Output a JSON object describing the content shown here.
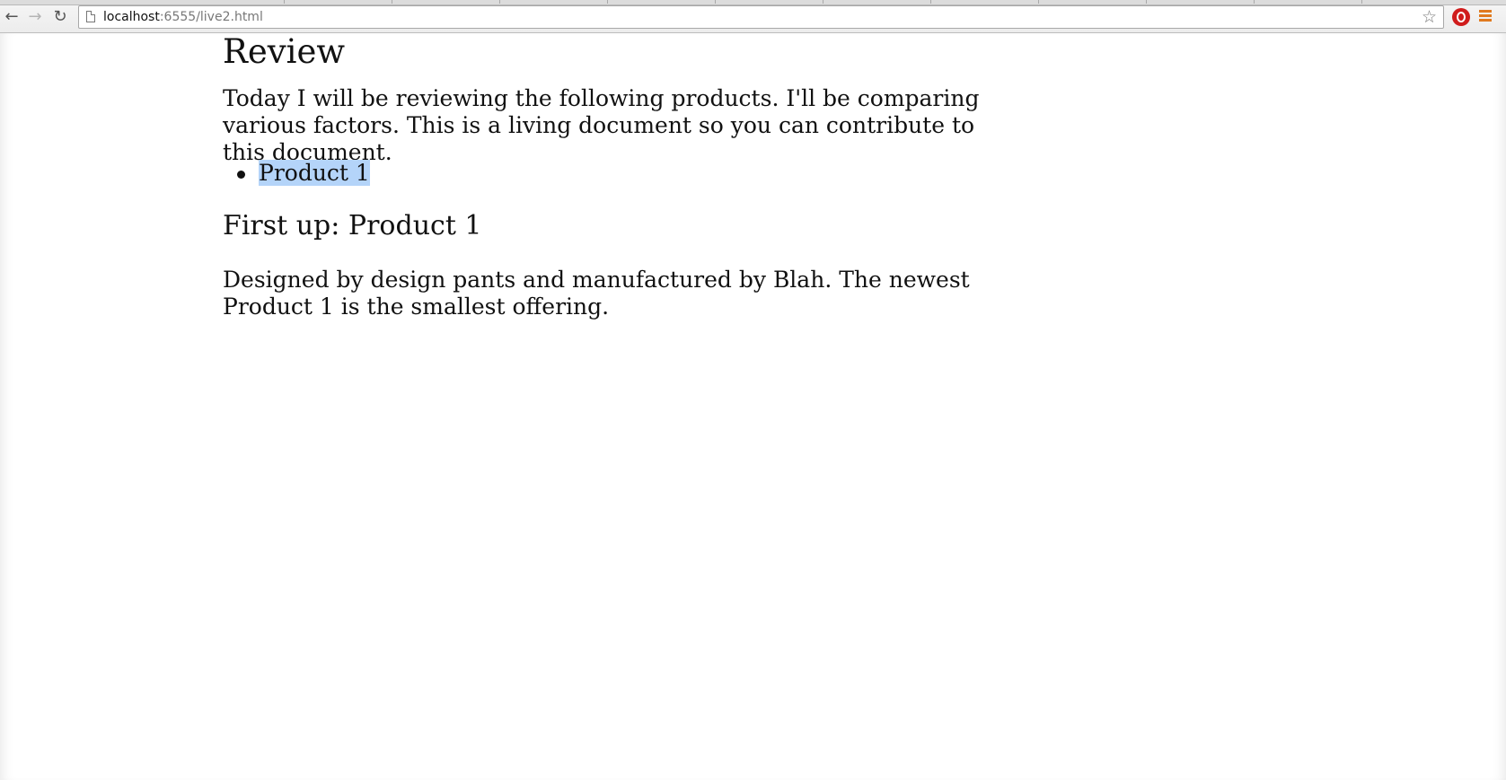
{
  "browser": {
    "url_host": "localhost",
    "url_rest": ":6555/live2.html",
    "back_icon": "arrow-left-icon",
    "forward_icon": "arrow-right-icon",
    "reload_icon": "reload-icon",
    "bookmark_icon": "star-icon",
    "extension_icon": "red-circle-extension-icon",
    "menu_icon": "hamburger-menu-icon",
    "colors": {
      "extension": "#d01c1c",
      "menu": "#e07a1f",
      "selection": "#b4d4f9"
    }
  },
  "page": {
    "title": "Review",
    "intro": "Today I will be reviewing the following products. I'll be comparing various factors. This is a living document so you can contribute to this document.",
    "list": [
      {
        "label": "Product 1",
        "selected": true
      }
    ],
    "section_heading": "First up: Product 1",
    "section_text": "Designed by design pants and manufactured by Blah. The newest Product 1 is the smallest offering."
  }
}
